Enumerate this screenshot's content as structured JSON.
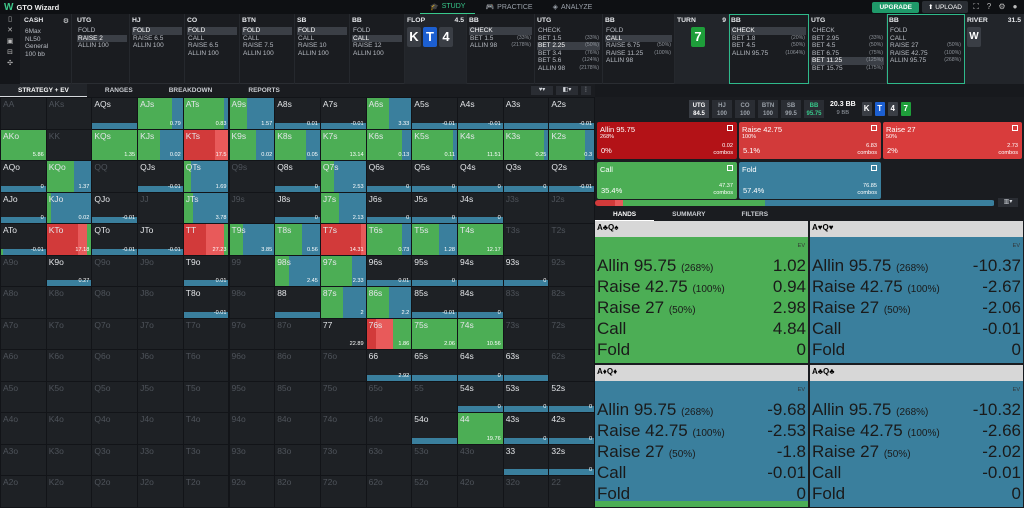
{
  "app": {
    "title": "GTO Wizard",
    "nav": [
      "STUDY",
      "PRACTICE",
      "ANALYZE"
    ],
    "upgrade": "UPGRADE",
    "upload": "UPLOAD"
  },
  "colors": {
    "allin": "#b31217",
    "raise": "#d23a3a",
    "raise_light": "#e85a5a",
    "call": "#4cae55",
    "fold": "#3a7f9d",
    "grey": "#d7d7d7"
  },
  "game": {
    "type": "CASH",
    "max": "6Max",
    "stakes": "NL50",
    "rake": "General",
    "stack": "100 bb"
  },
  "history": [
    {
      "pos": "UTG",
      "actions": [
        "FOLD",
        "RAISE 2",
        "ALLIN 100"
      ],
      "sel": 1
    },
    {
      "pos": "HJ",
      "actions": [
        "FOLD",
        "RAISE 6.5",
        "ALLIN 100"
      ],
      "sel": 0
    },
    {
      "pos": "CO",
      "actions": [
        "FOLD",
        "CALL",
        "RAISE 6.5",
        "ALLIN 100"
      ],
      "sel": 0
    },
    {
      "pos": "BTN",
      "actions": [
        "FOLD",
        "CALL",
        "RAISE 7.5",
        "ALLIN 100"
      ],
      "sel": 0
    },
    {
      "pos": "SB",
      "actions": [
        "FOLD",
        "CALL",
        "RAISE 10",
        "ALLIN 100"
      ],
      "sel": 0
    },
    {
      "pos": "BB",
      "actions": [
        "FOLD",
        "CALL",
        "RAISE 12",
        "ALLIN 100"
      ],
      "sel": 1
    }
  ],
  "flop": {
    "label": "FLOP",
    "pot": "4.5",
    "cards": [
      "K",
      "T",
      "4"
    ]
  },
  "flop_actions": [
    {
      "pos": "BB",
      "actions": [
        [
          "CHECK",
          ""
        ],
        [
          "BET 1.5",
          "(33%)"
        ],
        [
          "ALLIN 98",
          "(2178%)"
        ]
      ],
      "sel": 0
    },
    {
      "pos": "UTG",
      "actions": [
        [
          "CHECK",
          ""
        ],
        [
          "BET 1.5",
          "(33%)"
        ],
        [
          "BET 2.25",
          "(50%)"
        ],
        [
          "BET 3.4",
          "(76%)"
        ],
        [
          "BET 5.6",
          "(124%)"
        ],
        [
          "ALLIN 98",
          "(2178%)"
        ]
      ],
      "sel": 2
    },
    {
      "pos": "BB",
      "actions": [
        [
          "FOLD",
          ""
        ],
        [
          "CALL",
          ""
        ],
        [
          "RAISE 6.75",
          "(50%)"
        ],
        [
          "RAISE 11.25",
          "(100%)"
        ],
        [
          "ALLIN 98",
          ""
        ]
      ],
      "sel": 1
    }
  ],
  "turn": {
    "label": "TURN",
    "pot": "9",
    "card": "7"
  },
  "turn_actions": [
    {
      "pos": "BB",
      "actions": [
        [
          "CHECK",
          ""
        ],
        [
          "BET 1.8",
          "(20%)"
        ],
        [
          "BET 4.5",
          "(50%)"
        ],
        [
          "ALLIN 95.75",
          "(1064%)"
        ]
      ],
      "sel": 0
    },
    {
      "pos": "UTG",
      "actions": [
        [
          "CHECK",
          ""
        ],
        [
          "BET 2.95",
          "(33%)"
        ],
        [
          "BET 4.5",
          "(50%)"
        ],
        [
          "BET 6.75",
          "(75%)"
        ],
        [
          "BET 11.25",
          "(125%)"
        ],
        [
          "BET 15.75",
          "(175%)"
        ]
      ],
      "sel": 4
    },
    {
      "pos": "BB",
      "actions": [
        [
          "FOLD",
          ""
        ],
        [
          "CALL",
          ""
        ],
        [
          "RAISE 27",
          "(50%)"
        ],
        [
          "RAISE 42.75",
          "(100%)"
        ],
        [
          "ALLIN 95.75",
          "(268%)"
        ]
      ],
      "sel": -1
    }
  ],
  "river": {
    "label": "RIVER",
    "pot": "31.5"
  },
  "subtabs": [
    "STRATEGY + EV",
    "RANGES",
    "BREAKDOWN",
    "REPORTS"
  ],
  "positions": [
    {
      "n": "UTG",
      "s": "84.5"
    },
    {
      "n": "HJ",
      "s": "100"
    },
    {
      "n": "CO",
      "s": "100"
    },
    {
      "n": "BTN",
      "s": "100"
    },
    {
      "n": "SB",
      "s": "99.5"
    },
    {
      "n": "BB",
      "s": "95.75"
    }
  ],
  "pot": {
    "main": "20.3 BB",
    "sub": "9 BB"
  },
  "action_boxes": [
    {
      "name": "Allin 95.75",
      "sub": "268%",
      "freq": "0%",
      "ev": "0.02",
      "combos": "combos",
      "color": "#b31217"
    },
    {
      "name": "Raise 42.75",
      "sub": "100%",
      "freq": "5.1%",
      "ev": "6.83",
      "combos": "combos",
      "color": "#d23a3a"
    },
    {
      "name": "Raise 27",
      "sub": "50%",
      "freq": "2%",
      "ev": "2.73",
      "combos": "combos",
      "color": "#d93c3c"
    },
    {
      "name": "Call",
      "sub": "",
      "freq": "35.4%",
      "ev": "47.37",
      "combos": "combos",
      "color": "#4cae55"
    },
    {
      "name": "Fold",
      "sub": "",
      "freq": "57.4%",
      "ev": "76.85",
      "combos": "combos",
      "color": "#3a7f9d"
    }
  ],
  "right_tabs": [
    "HANDS",
    "SUMMARY",
    "FILTERS"
  ],
  "combos": [
    {
      "hand": "A♣Q♠",
      "rows": [
        [
          "Allin 95.75",
          "(268%)",
          "1.02"
        ],
        [
          "Raise 42.75",
          "(100%)",
          "0.94"
        ],
        [
          "Raise 27",
          "(50%)",
          "2.98"
        ],
        [
          "Call",
          "",
          "4.84"
        ],
        [
          "Fold",
          "",
          "0"
        ]
      ],
      "mix": [
        0,
        0,
        0,
        1,
        0
      ]
    },
    {
      "hand": "A♥Q♥",
      "rows": [
        [
          "Allin 95.75",
          "(268%)",
          "-10.37"
        ],
        [
          "Raise 42.75",
          "(100%)",
          "-2.67"
        ],
        [
          "Raise 27",
          "(50%)",
          "-2.06"
        ],
        [
          "Call",
          "",
          "-0.01"
        ],
        [
          "Fold",
          "",
          "0"
        ]
      ],
      "mix": [
        0,
        0,
        0,
        0,
        1
      ]
    },
    {
      "hand": "A♦Q♦",
      "rows": [
        [
          "Allin 95.75",
          "(268%)",
          "-9.68"
        ],
        [
          "Raise 42.75",
          "(100%)",
          "-2.53"
        ],
        [
          "Raise 27",
          "(50%)",
          "-1.8"
        ],
        [
          "Call",
          "",
          "-0.01"
        ],
        [
          "Fold",
          "",
          "0"
        ]
      ],
      "mix": [
        0,
        0,
        0,
        0.05,
        0.95
      ]
    },
    {
      "hand": "A♣Q♣",
      "rows": [
        [
          "Allin 95.75",
          "(268%)",
          "-10.32"
        ],
        [
          "Raise 42.75",
          "(100%)",
          "-2.66"
        ],
        [
          "Raise 27",
          "(50%)",
          "-2.02"
        ],
        [
          "Call",
          "",
          "-0.01"
        ],
        [
          "Fold",
          "",
          "0"
        ]
      ],
      "mix": [
        0,
        0,
        0,
        0,
        1
      ]
    }
  ],
  "ev_label": "EV",
  "grid": [
    [
      "AA",
      "AKs",
      "AQs",
      "AJs",
      "ATs",
      "A9s",
      "A8s",
      "A7s",
      "A6s",
      "A5s",
      "A4s",
      "A3s",
      "A2s"
    ],
    [
      "AKo",
      "KK",
      "KQs",
      "KJs",
      "KTs",
      "K9s",
      "K8s",
      "K7s",
      "K6s",
      "K5s",
      "K4s",
      "K3s",
      "K2s"
    ],
    [
      "AQo",
      "KQo",
      "QQ",
      "QJs",
      "QTs",
      "Q9s",
      "Q8s",
      "Q7s",
      "Q6s",
      "Q5s",
      "Q4s",
      "Q3s",
      "Q2s"
    ],
    [
      "AJo",
      "KJo",
      "QJo",
      "JJ",
      "JTs",
      "J9s",
      "J8s",
      "J7s",
      "J6s",
      "J5s",
      "J4s",
      "J3s",
      "J2s"
    ],
    [
      "ATo",
      "KTo",
      "QTo",
      "JTo",
      "TT",
      "T9s",
      "T8s",
      "T7s",
      "T6s",
      "T5s",
      "T4s",
      "T3s",
      "T2s"
    ],
    [
      "A9o",
      "K9o",
      "Q9o",
      "J9o",
      "T9o",
      "99",
      "98s",
      "97s",
      "96s",
      "95s",
      "94s",
      "93s",
      "92s"
    ],
    [
      "A8o",
      "K8o",
      "Q8o",
      "J8o",
      "T8o",
      "98o",
      "88",
      "87s",
      "86s",
      "85s",
      "84s",
      "83s",
      "82s"
    ],
    [
      "A7o",
      "K7o",
      "Q7o",
      "J7o",
      "T7o",
      "97o",
      "87o",
      "77",
      "76s",
      "75s",
      "74s",
      "73s",
      "72s"
    ],
    [
      "A6o",
      "K6o",
      "Q6o",
      "J6o",
      "T6o",
      "96o",
      "86o",
      "76o",
      "66",
      "65s",
      "64s",
      "63s",
      "62s"
    ],
    [
      "A5o",
      "K5o",
      "Q5o",
      "J5o",
      "T5o",
      "95o",
      "85o",
      "75o",
      "65o",
      "55",
      "54s",
      "53s",
      "52s"
    ],
    [
      "A4o",
      "K4o",
      "Q4o",
      "J4o",
      "T4o",
      "94o",
      "84o",
      "74o",
      "64o",
      "54o",
      "44",
      "43s",
      "42s"
    ],
    [
      "A3o",
      "K3o",
      "Q3o",
      "J3o",
      "T3o",
      "93o",
      "83o",
      "73o",
      "63o",
      "53o",
      "43o",
      "33",
      "32s"
    ],
    [
      "A2o",
      "K2o",
      "Q2o",
      "J2o",
      "T2o",
      "92o",
      "82o",
      "72o",
      "62o",
      "52o",
      "42o",
      "32o",
      "22"
    ]
  ],
  "cells": {
    "AQs": {
      "ev": "",
      "mix": [
        0,
        0,
        0,
        0,
        1
      ]
    },
    "AJs": {
      "ev": "0.79",
      "mix": [
        0,
        0,
        0,
        0.75,
        0.25
      ]
    },
    "ATs": {
      "ev": "0.83",
      "mix": [
        0,
        0,
        0,
        0.9,
        0.1
      ]
    },
    "A9s": {
      "ev": "1.57",
      "mix": [
        0,
        0,
        0,
        0.4,
        0.6
      ]
    },
    "A8s": {
      "ev": "0.01",
      "mix": [
        0,
        0,
        0,
        0,
        1
      ]
    },
    "A7s": {
      "ev": "-0.01",
      "mix": [
        0,
        0,
        0,
        0,
        1
      ]
    },
    "A6s": {
      "ev": "3.33",
      "mix": [
        0,
        0,
        0,
        0.5,
        0.5
      ]
    },
    "A5s": {
      "ev": "-0.01",
      "mix": [
        0,
        0,
        0,
        0,
        1
      ]
    },
    "A4s": {
      "ev": "-0.01",
      "mix": [
        0,
        0,
        0,
        0,
        1
      ]
    },
    "A3s": {
      "ev": "",
      "mix": [
        0,
        0,
        0,
        0,
        1
      ]
    },
    "A2s": {
      "ev": "-0.01",
      "mix": [
        0,
        0,
        0,
        0,
        1
      ]
    },
    "AKo": {
      "ev": "5.86",
      "mix": [
        0,
        0,
        0,
        1,
        0
      ]
    },
    "KQs": {
      "ev": "1.35",
      "mix": [
        0,
        0,
        0,
        1,
        0
      ]
    },
    "KJs": {
      "ev": "0.02",
      "mix": [
        0,
        0,
        0,
        0.5,
        0.5
      ]
    },
    "KTs": {
      "ev": "17.5",
      "mix": [
        0,
        0.7,
        0.3,
        0,
        0
      ]
    },
    "K9s": {
      "ev": "0.02",
      "mix": [
        0,
        0,
        0,
        0.6,
        0.4
      ]
    },
    "K8s": {
      "ev": "0.05",
      "mix": [
        0,
        0,
        0,
        0.7,
        0.3
      ]
    },
    "K7s": {
      "ev": "13.14",
      "mix": [
        0,
        0,
        0,
        1,
        0
      ]
    },
    "K6s": {
      "ev": "0.13",
      "mix": [
        0,
        0,
        0,
        0.8,
        0.2
      ]
    },
    "K5s": {
      "ev": "0.11",
      "mix": [
        0,
        0,
        0,
        0.9,
        0.1
      ]
    },
    "K4s": {
      "ev": "11.51",
      "mix": [
        0,
        0,
        0,
        1,
        0
      ]
    },
    "K3s": {
      "ev": "0.25",
      "mix": [
        0,
        0,
        0,
        0.9,
        0.1
      ]
    },
    "K2s": {
      "ev": "0.3",
      "mix": [
        0,
        0,
        0,
        0.8,
        0.2
      ]
    },
    "AQo": {
      "ev": "0",
      "mix": [
        0,
        0,
        0,
        0,
        1
      ]
    },
    "KQo": {
      "ev": "1.37",
      "mix": [
        0,
        0,
        0,
        0.6,
        0.4
      ]
    },
    "QJs": {
      "ev": "-0.01",
      "mix": [
        0,
        0,
        0,
        0,
        1
      ]
    },
    "QTs": {
      "ev": "1.69",
      "mix": [
        0,
        0,
        0,
        0.15,
        0.85
      ]
    },
    "Q8s": {
      "ev": "0",
      "mix": [
        0,
        0,
        0,
        0,
        1
      ]
    },
    "Q7s": {
      "ev": "2.53",
      "mix": [
        0,
        0,
        0,
        0.3,
        0.7
      ]
    },
    "Q6s": {
      "ev": "0",
      "mix": [
        0,
        0,
        0,
        0,
        1
      ]
    },
    "Q5s": {
      "ev": "0",
      "mix": [
        0,
        0,
        0,
        0,
        1
      ]
    },
    "Q4s": {
      "ev": "0",
      "mix": [
        0,
        0,
        0,
        0,
        1
      ]
    },
    "Q3s": {
      "ev": "0",
      "mix": [
        0,
        0,
        0,
        0,
        1
      ]
    },
    "Q2s": {
      "ev": "-0.01",
      "mix": [
        0,
        0,
        0,
        0,
        1
      ]
    },
    "AJo": {
      "ev": "0",
      "mix": [
        0,
        0,
        0,
        0,
        1
      ]
    },
    "KJo": {
      "ev": "0.02",
      "mix": [
        0,
        0,
        0,
        0.1,
        0.9
      ]
    },
    "QJo": {
      "ev": "-0.01",
      "mix": [
        0,
        0,
        0,
        0,
        1
      ]
    },
    "JTs": {
      "ev": "3.78",
      "mix": [
        0,
        0,
        0,
        0.2,
        0.8
      ]
    },
    "J8s": {
      "ev": "0",
      "mix": [
        0,
        0,
        0,
        0,
        1
      ]
    },
    "J7s": {
      "ev": "2.13",
      "mix": [
        0,
        0,
        0,
        0.4,
        0.6
      ]
    },
    "J6s": {
      "ev": "0",
      "mix": [
        0,
        0,
        0,
        0,
        1
      ]
    },
    "J5s": {
      "ev": "0",
      "mix": [
        0,
        0,
        0,
        0,
        1
      ]
    },
    "J4s": {
      "ev": "0",
      "mix": [
        0,
        0,
        0,
        0,
        1
      ]
    },
    "ATo": {
      "ev": "-0.01",
      "mix": [
        0,
        0,
        0,
        0.05,
        0.95
      ]
    },
    "KTo": {
      "ev": "17.18",
      "mix": [
        0,
        0.7,
        0.2,
        0.1,
        0
      ]
    },
    "QTo": {
      "ev": "-0.01",
      "mix": [
        0,
        0,
        0,
        0,
        1
      ]
    },
    "JTo": {
      "ev": "-0.01",
      "mix": [
        0,
        0,
        0,
        0,
        1
      ]
    },
    "TT": {
      "ev": "27.23",
      "mix": [
        0,
        0.5,
        0.4,
        0.1,
        0
      ]
    },
    "T9s": {
      "ev": "3.85",
      "mix": [
        0,
        0,
        0,
        0.3,
        0.7
      ]
    },
    "T8s": {
      "ev": "0.56",
      "mix": [
        0,
        0,
        0,
        0.6,
        0.4
      ]
    },
    "T7s": {
      "ev": "14.31",
      "mix": [
        0,
        0.9,
        0.1,
        0,
        0
      ]
    },
    "T6s": {
      "ev": "0.73",
      "mix": [
        0,
        0,
        0,
        0.8,
        0.2
      ]
    },
    "T5s": {
      "ev": "1.28",
      "mix": [
        0,
        0,
        0,
        0.6,
        0.4
      ]
    },
    "T4s": {
      "ev": "12.17",
      "mix": [
        0,
        0,
        0,
        1,
        0
      ]
    },
    "K9o": {
      "ev": "0.27",
      "mix": [
        0,
        0,
        0,
        0,
        1
      ]
    },
    "T9o": {
      "ev": "0.01",
      "mix": [
        0,
        0,
        0,
        0,
        1
      ]
    },
    "98s": {
      "ev": "2.45",
      "mix": [
        0,
        0,
        0,
        0.3,
        0.7
      ]
    },
    "97s": {
      "ev": "2.33",
      "mix": [
        0,
        0,
        0,
        0.7,
        0.3
      ]
    },
    "96s": {
      "ev": "0.01",
      "mix": [
        0,
        0,
        0,
        0,
        1
      ]
    },
    "95s": {
      "ev": "0",
      "mix": [
        0,
        0,
        0,
        0,
        1
      ]
    },
    "94s": {
      "ev": "",
      "mix": [
        0,
        0,
        0,
        0,
        1
      ]
    },
    "93s": {
      "ev": "0",
      "mix": [
        0,
        0,
        0,
        0,
        1
      ]
    },
    "T8o": {
      "ev": "-0.01",
      "mix": [
        0,
        0,
        0,
        0,
        1
      ]
    },
    "88": {
      "ev": "",
      "mix": [
        0,
        0,
        0,
        0,
        1
      ]
    },
    "87s": {
      "ev": "2",
      "mix": [
        0,
        0,
        0,
        0.5,
        0.5
      ]
    },
    "86s": {
      "ev": "2.2",
      "mix": [
        0,
        0,
        0,
        0.5,
        0.5
      ]
    },
    "85s": {
      "ev": "-0.01",
      "mix": [
        0,
        0,
        0,
        0,
        1
      ]
    },
    "84s": {
      "ev": "0",
      "mix": [
        0,
        0,
        0,
        0,
        1
      ]
    },
    "77": {
      "ev": "22.89",
      "mix": [
        0,
        0,
        0,
        0,
        0
      ]
    },
    "76s": {
      "ev": "1.86",
      "mix": [
        0,
        0.2,
        0.4,
        0.4,
        0
      ]
    },
    "75s": {
      "ev": "2.06",
      "mix": [
        0,
        0,
        0,
        1,
        0
      ]
    },
    "74s": {
      "ev": "10.56",
      "mix": [
        0,
        0,
        0,
        1,
        0
      ]
    },
    "66": {
      "ev": "2.92",
      "mix": [
        0,
        0,
        0,
        0,
        1
      ]
    },
    "65s": {
      "ev": "",
      "mix": [
        0,
        0,
        0,
        0,
        1
      ]
    },
    "64s": {
      "ev": "0",
      "mix": [
        0,
        0,
        0,
        0,
        1
      ]
    },
    "63s": {
      "ev": "",
      "mix": [
        0,
        0,
        0,
        0,
        1
      ]
    },
    "54s": {
      "ev": "0",
      "mix": [
        0,
        0,
        0,
        0,
        1
      ]
    },
    "53s": {
      "ev": "0",
      "mix": [
        0,
        0,
        0,
        0,
        1
      ]
    },
    "52s": {
      "ev": "0",
      "mix": [
        0,
        0,
        0,
        0,
        1
      ]
    },
    "54o": {
      "ev": "",
      "mix": [
        0,
        0,
        0,
        0,
        1
      ]
    },
    "44": {
      "ev": "19.76",
      "mix": [
        0,
        0,
        0,
        1,
        0
      ]
    },
    "43s": {
      "ev": "0",
      "mix": [
        0,
        0,
        0,
        0,
        1
      ]
    },
    "42s": {
      "ev": "0",
      "mix": [
        0,
        0,
        0,
        0,
        1
      ]
    },
    "33": {
      "ev": "",
      "mix": [
        0,
        0,
        0,
        0,
        1
      ]
    },
    "32s": {
      "ev": "0",
      "mix": [
        0,
        0,
        0,
        0,
        1
      ]
    }
  },
  "freqbar": [
    0,
    0.05,
    0.02,
    0.354,
    0.574
  ]
}
